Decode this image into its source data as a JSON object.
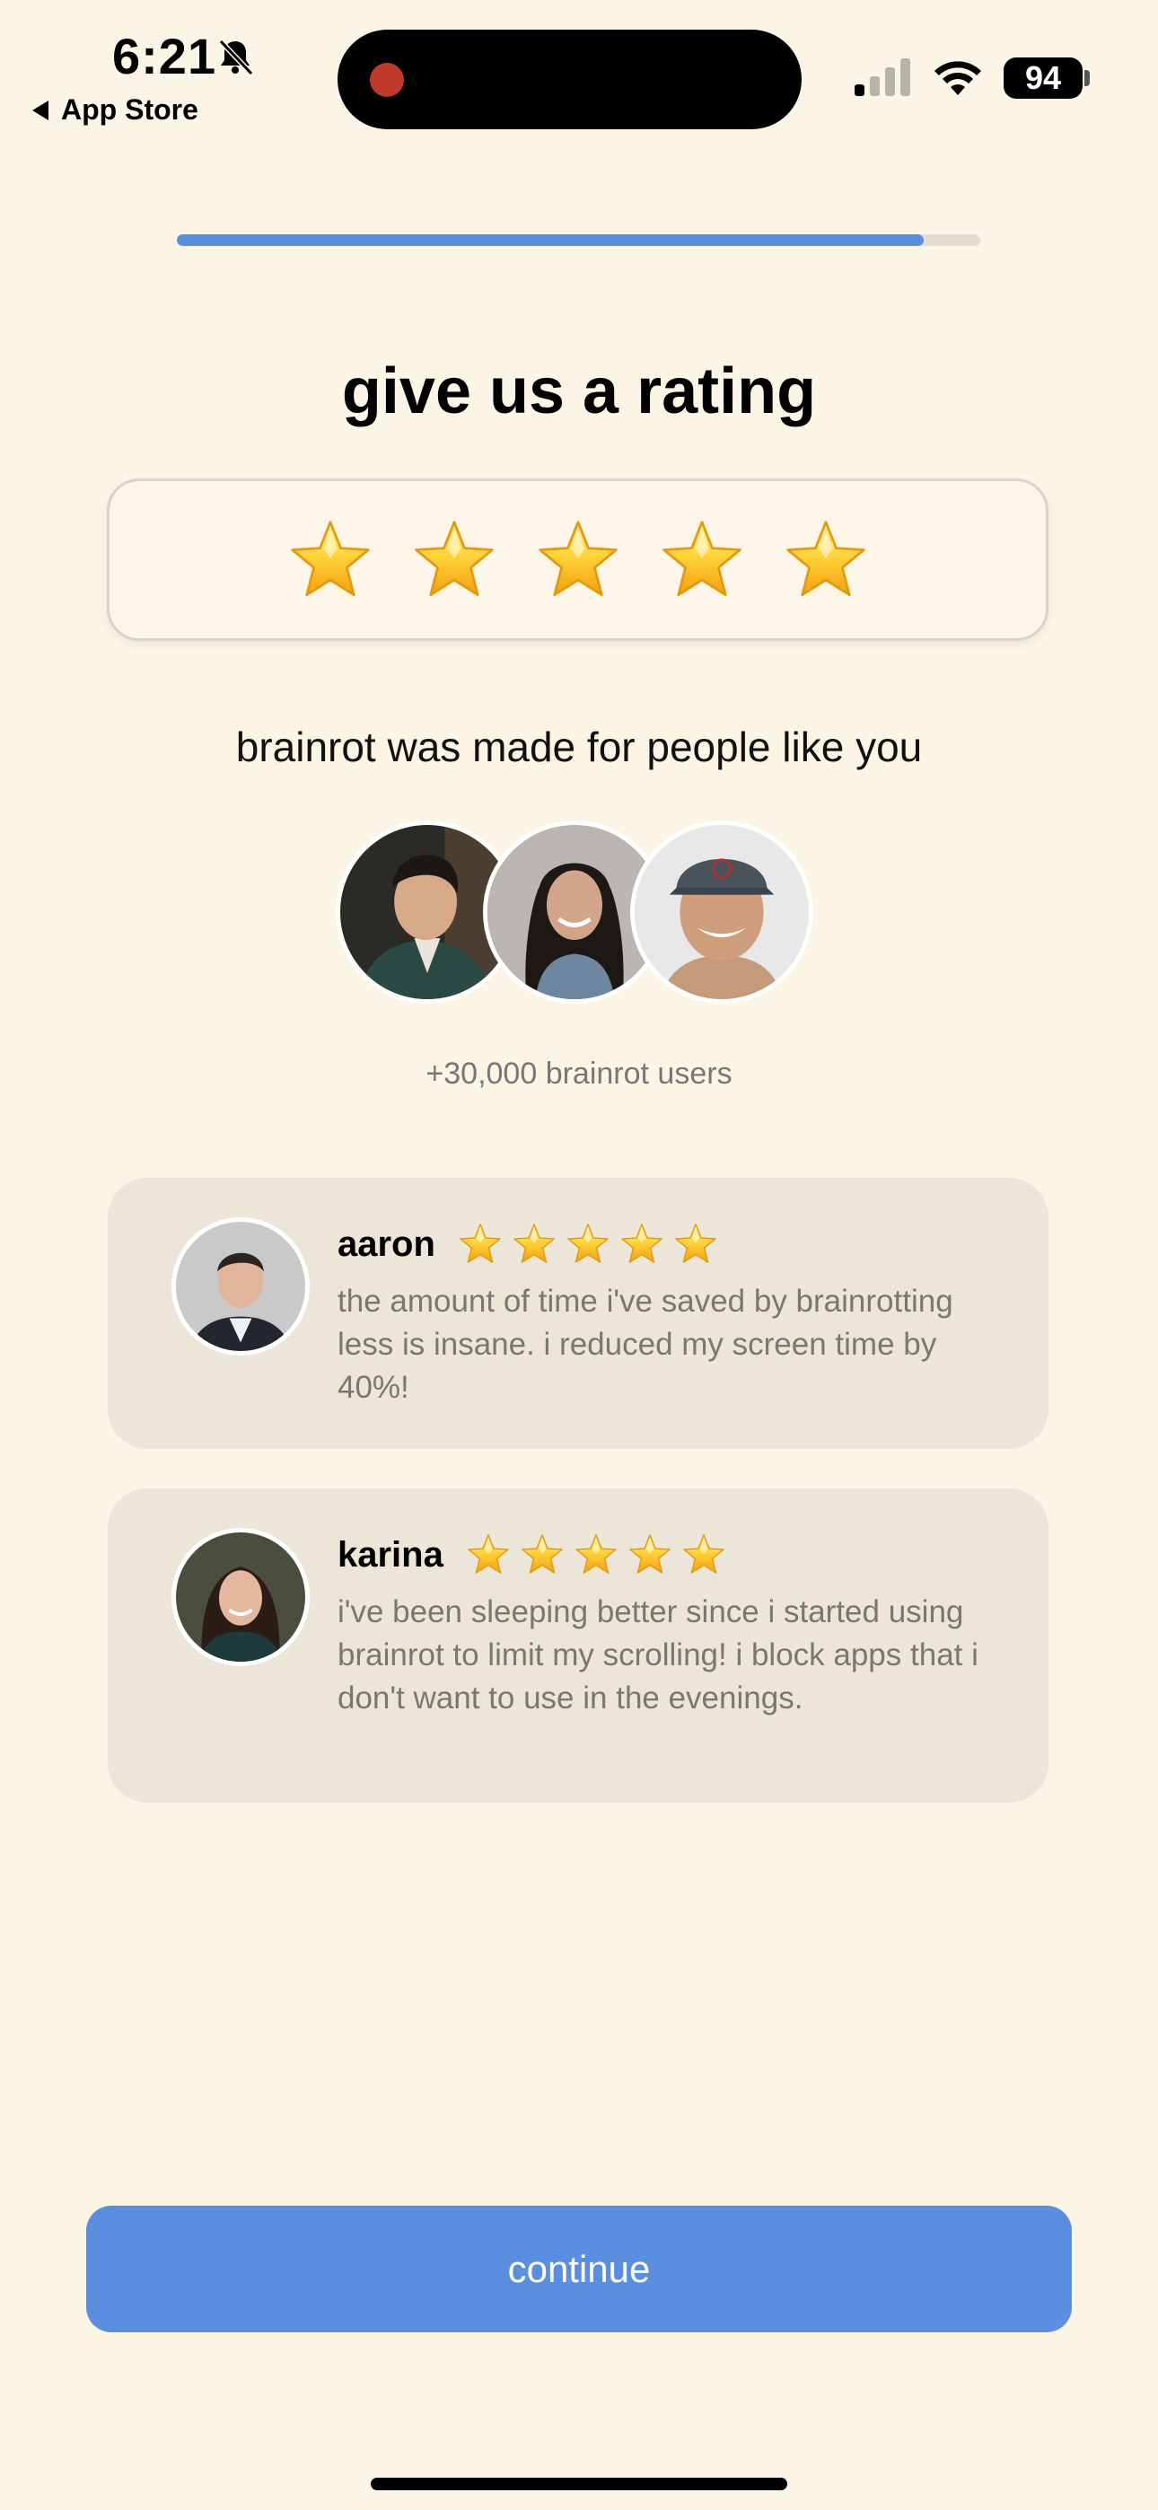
{
  "status_bar": {
    "time": "6:21",
    "back_label": "App Store",
    "battery": "94"
  },
  "progress": {
    "value": 0.93
  },
  "title": "give us a rating",
  "rating": {
    "stars": 5
  },
  "subtitle": "brainrot was made for people like you",
  "users_count": "+30,000 brainrot users",
  "reviews": [
    {
      "name": "aaron",
      "stars": 5,
      "text": "the amount of time i've saved by brainrotting less is insane. i reduced my screen time by 40%!"
    },
    {
      "name": "karina",
      "stars": 5,
      "text": "i've been sleeping better since i started using brainrot to limit my scrolling! i block apps that i don't want to use in the evenings."
    }
  ],
  "continue_label": "continue",
  "colors": {
    "background": "#faf5e4",
    "accent": "#5a8fdf",
    "card": "#ece6d9"
  }
}
